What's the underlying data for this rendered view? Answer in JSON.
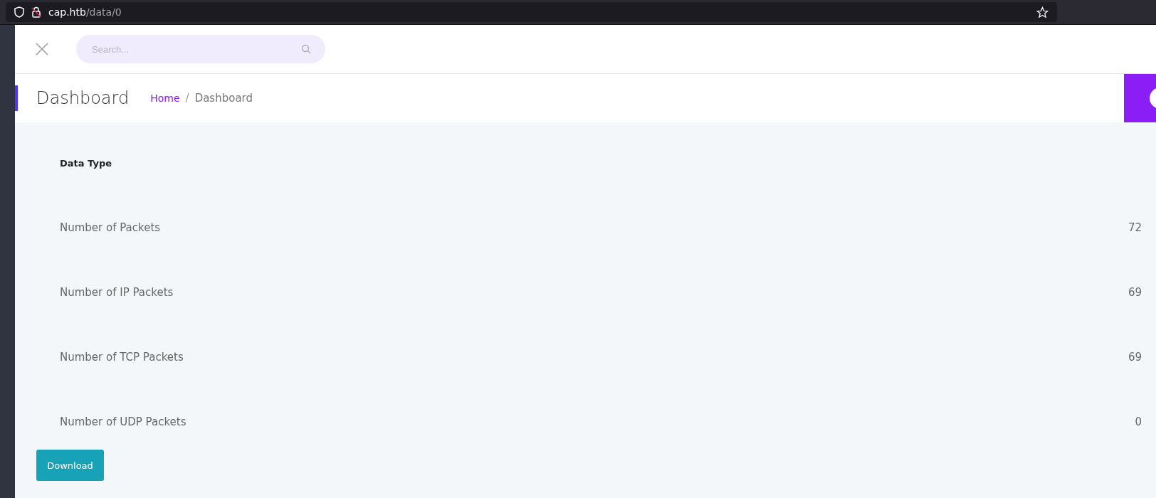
{
  "browser": {
    "url_host": "cap.htb",
    "url_path": "/data/0"
  },
  "search": {
    "placeholder": "Search..."
  },
  "page_title": "Dashboard",
  "breadcrumb": [
    {
      "label": "Home",
      "kind": "link"
    },
    {
      "label": "/",
      "kind": "separator"
    },
    {
      "label": "Dashboard",
      "kind": "current"
    }
  ],
  "table": {
    "columns": [
      "Data Type"
    ],
    "rows": [
      {
        "label": "Number of Packets",
        "value": "72"
      },
      {
        "label": "Number of IP Packets",
        "value": "69"
      },
      {
        "label": "Number of TCP Packets",
        "value": "69"
      },
      {
        "label": "Number of UDP Packets",
        "value": "0"
      }
    ]
  },
  "download_button": "Download"
}
